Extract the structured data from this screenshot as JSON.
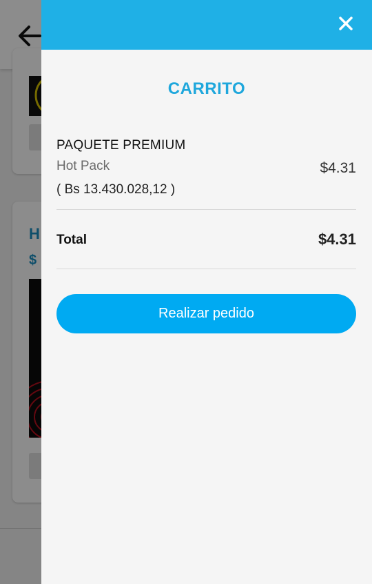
{
  "background": {
    "card_title_partial": "H",
    "card_price_partial": "$ ."
  },
  "drawer": {
    "title": "CARRITO",
    "close_icon": "close-icon",
    "items": [
      {
        "name": "PAQUETE PREMIUM",
        "subtitle": "Hot Pack",
        "local_price": "( Bs 13.430.028,12 )",
        "price": "$4.31"
      }
    ],
    "total_label": "Total",
    "total_value": "$4.31",
    "order_button_label": "Realizar pedido"
  },
  "colors": {
    "header": "#1fb0e6",
    "title": "#1fa7dc",
    "button": "#00aaf2"
  }
}
